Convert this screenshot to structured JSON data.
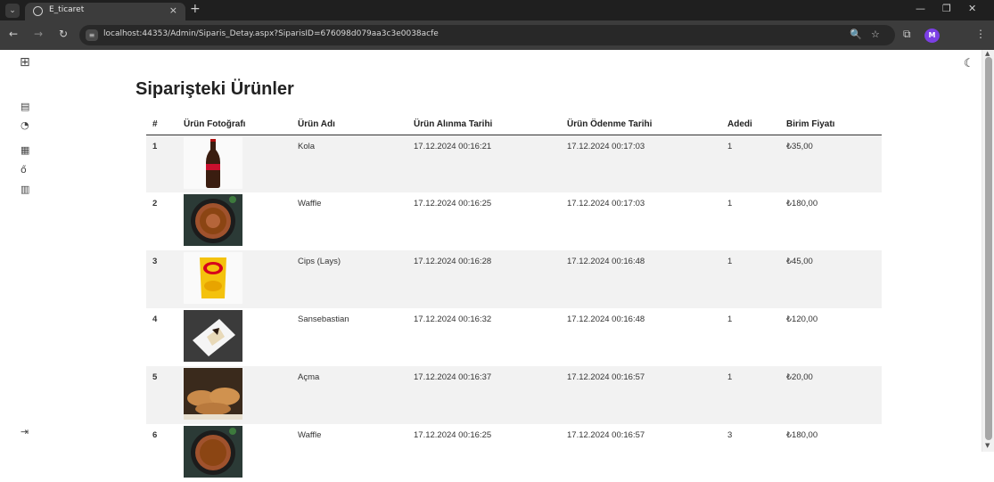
{
  "browser": {
    "tab_title": "E_ticaret",
    "tab_close": "×",
    "new_tab": "+",
    "url": "localhost:44353/Admin/Siparis_Detay.aspx?SiparisID=676098d079aa3c3e0038acfe",
    "profile_initial": "M"
  },
  "page": {
    "title": "Siparişteki Ürünler"
  },
  "table": {
    "headers": [
      "#",
      "Ürün Fotoğrafı",
      "Ürün Adı",
      "Ürün Alınma Tarihi",
      "Ürün Ödenme Tarihi",
      "Adedi",
      "Birim Fiyatı"
    ],
    "rows": [
      {
        "no": "1",
        "photo": "cola-bottle",
        "name": "Kola",
        "bought": "17.12.2024 00:16:21",
        "paid": "17.12.2024 00:17:03",
        "qty": "1",
        "price": "₺35,00"
      },
      {
        "no": "2",
        "photo": "waffle",
        "name": "Waffle",
        "bought": "17.12.2024 00:16:25",
        "paid": "17.12.2024 00:17:03",
        "qty": "1",
        "price": "₺180,00"
      },
      {
        "no": "3",
        "photo": "lays-chips",
        "name": "Cips (Lays)",
        "bought": "17.12.2024 00:16:28",
        "paid": "17.12.2024 00:16:48",
        "qty": "1",
        "price": "₺45,00"
      },
      {
        "no": "4",
        "photo": "cheesecake",
        "name": "Sansebastian",
        "bought": "17.12.2024 00:16:32",
        "paid": "17.12.2024 00:16:48",
        "qty": "1",
        "price": "₺120,00"
      },
      {
        "no": "5",
        "photo": "acma-pastry",
        "name": "Açma",
        "bought": "17.12.2024 00:16:37",
        "paid": "17.12.2024 00:16:57",
        "qty": "1",
        "price": "₺20,00"
      },
      {
        "no": "6",
        "photo": "waffle",
        "name": "Waffle",
        "bought": "17.12.2024 00:16:25",
        "paid": "17.12.2024 00:16:57",
        "qty": "3",
        "price": "₺180,00"
      }
    ]
  },
  "icons": {
    "sidebar": [
      "grid-icon",
      "receipt-icon",
      "gauge-icon",
      "table-icon",
      "glasses-icon",
      "list-icon",
      "logout-icon"
    ],
    "theme": "moon-icon"
  },
  "colors": {
    "row_stripe": "#f2f2f2",
    "browser_chrome": "#3c3c3c",
    "avatar": "#7b3fe4"
  }
}
